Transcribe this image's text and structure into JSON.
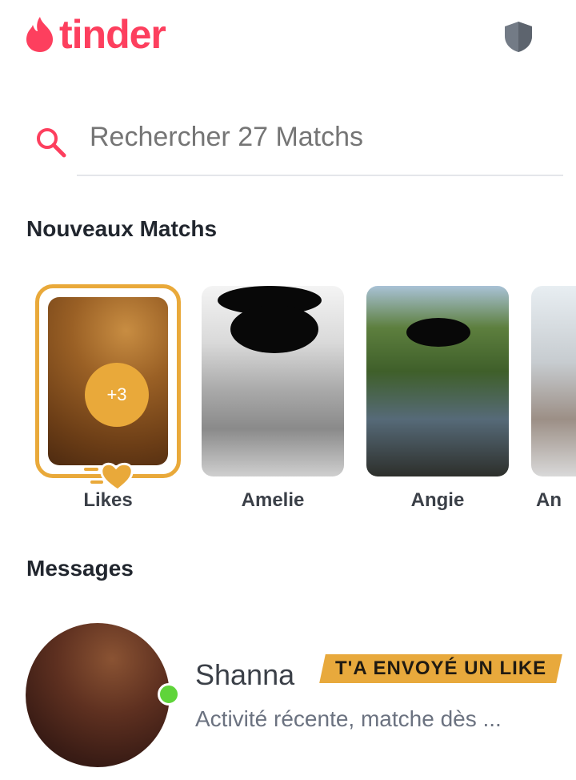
{
  "app": {
    "logo_text": "tinder",
    "brand_color": "#fd3f5e",
    "accent_gold": "#e9a93a"
  },
  "header": {
    "shield_icon": "shield-icon"
  },
  "search": {
    "placeholder": "Rechercher 27 Matchs",
    "icon": "search-icon"
  },
  "new_matches": {
    "title": "Nouveaux Matchs",
    "likes": {
      "count_label": "+3",
      "label": "Likes"
    },
    "items": [
      {
        "name": "Amelie"
      },
      {
        "name": "Angie"
      },
      {
        "name": "An"
      }
    ]
  },
  "messages": {
    "title": "Messages",
    "items": [
      {
        "name": "Shanna",
        "badge": "T'A ENVOYÉ UN LIKE",
        "preview": "Activité récente, matche dès ...",
        "online": true
      }
    ]
  }
}
